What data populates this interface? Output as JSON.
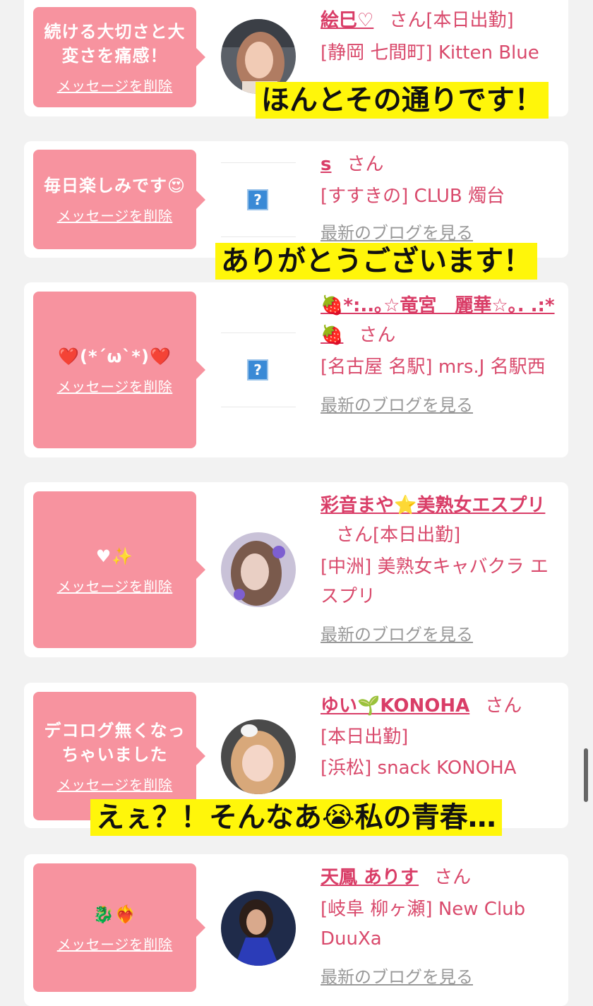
{
  "delete_label": "メッセージを削除",
  "blog_label": "最新のブログを見る",
  "cards": [
    {
      "message": "続ける大切さと大変さを痛感！",
      "name": "絵巳♡",
      "san": "さん[本日出勤]",
      "shop": "[静岡 七間町] Kitten Blue",
      "caption": "ほんとその通りです！"
    },
    {
      "message": "毎日楽しみです😍",
      "name": "s",
      "san": "さん",
      "shop": "[すすきの] CLUB 燭台",
      "blog": "最新のブログを見る",
      "caption": "ありがとうございます！"
    },
    {
      "message": "❤️(*´ω`*)❤️",
      "name": "🍓*:..｡☆竜宮　麗華☆｡. .:*🍓",
      "san": "さん",
      "shop": "[名古屋 名駅] mrs.J 名駅西",
      "blog": "最新のブログを見る"
    },
    {
      "message": "♥✨",
      "name": "彩音まや⭐美熟女エスプリ",
      "san": "さん[本日出勤]",
      "shop": "[中洲] 美熟女キャバクラ エスプリ",
      "blog": "最新のブログを見る"
    },
    {
      "message": "デコログ無くなっちゃいました",
      "name": "ゆい🌱KONOHA",
      "san": "さん",
      "status": "[本日出勤]",
      "shop": "[浜松] snack KONOHA",
      "caption": "えぇ？！そんなあ😭私の青春…"
    },
    {
      "message": "🐉❤️‍🔥",
      "name": "天鳳 ありす",
      "san": "さん",
      "shop": "[岐阜 柳ヶ瀬] New Club DuuXa",
      "blog": "最新のブログを見る"
    }
  ],
  "colors": {
    "accent": "#d93d67",
    "bubble": "#f7939f",
    "caption_bg": "#fff60a"
  }
}
